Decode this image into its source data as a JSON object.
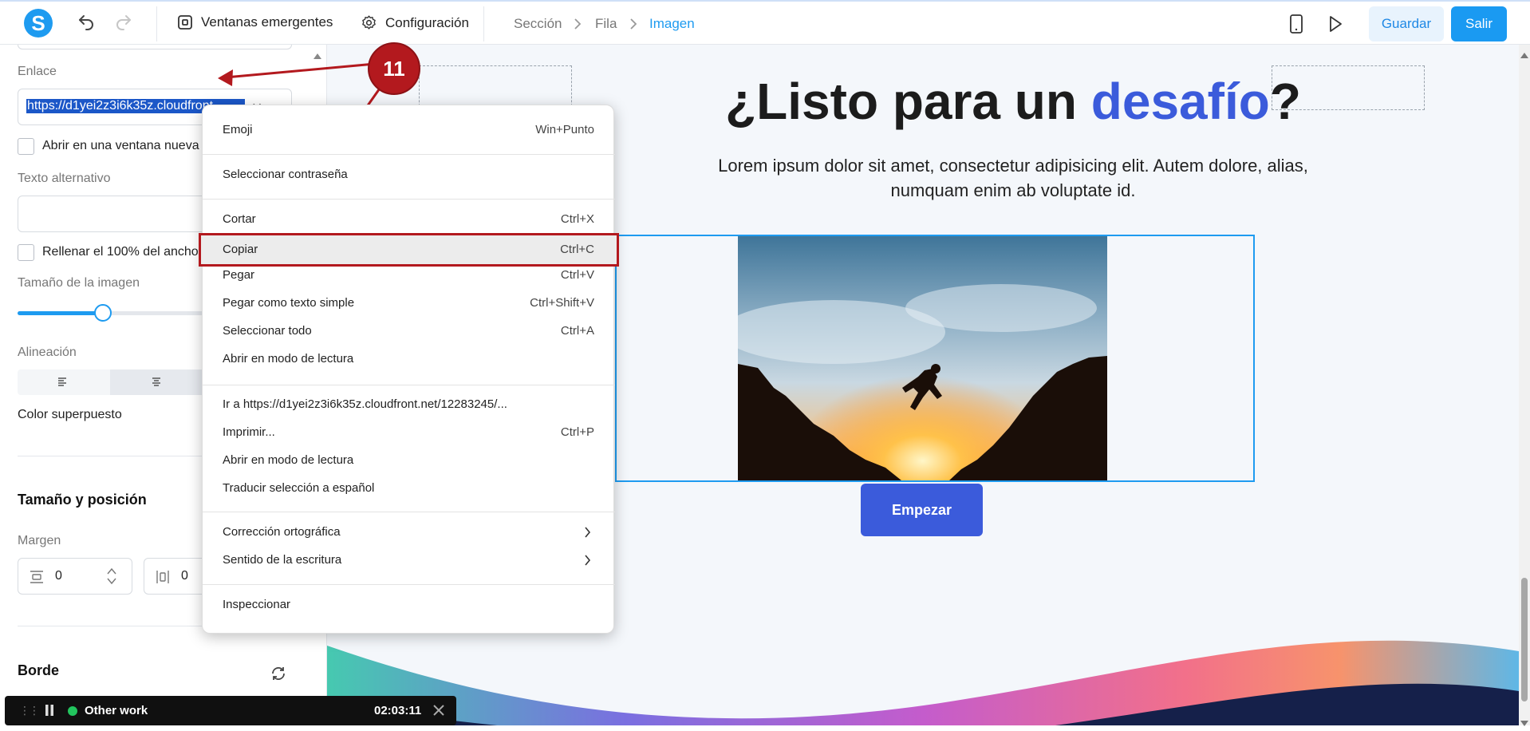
{
  "toolbar": {
    "logo": "S",
    "popups_label": "Ventanas emergentes",
    "settings_label": "Configuración",
    "breadcrumb": [
      "Sección",
      "Fila",
      "Imagen"
    ],
    "save_label": "Guardar",
    "exit_label": "Salir"
  },
  "left_panel": {
    "link_label": "Enlace",
    "link_value": "https://d1yei2z3i6k35z.cloudfront",
    "new_window_label": "Abrir en una ventana nueva",
    "alt_label": "Texto alternativo",
    "fill_width_label": "Rellenar el 100% del ancho",
    "image_size_label": "Tamaño de la imagen",
    "image_size_value": 0.5,
    "alignment_label": "Alineación",
    "overlay_label": "Color superpuesto",
    "size_position_title": "Tamaño y posición",
    "margin_label": "Margen",
    "margin_top": "0",
    "margin_side": "0",
    "border_title": "Borde"
  },
  "canvas": {
    "heading_part1": "¿Listo para un ",
    "heading_highlight": "desafío",
    "heading_part2": "?",
    "body_line1": "Lorem ipsum dolor sit amet, consectetur adipisicing elit. Autem dolore, alias,",
    "body_line2": "numquam enim ab voluptate id.",
    "cta_label": "Empezar",
    "accent_color": "#3b5bdb"
  },
  "annotation": {
    "step_number": "11",
    "color": "#b3191e"
  },
  "context_menu": {
    "items": [
      {
        "label": "Emoji",
        "shortcut": "Win+Punto"
      },
      {
        "label": "Seleccionar contraseña",
        "shortcut": ""
      },
      {
        "label": "Cortar",
        "shortcut": "Ctrl+X"
      },
      {
        "label": "Copiar",
        "shortcut": "Ctrl+C"
      },
      {
        "label": "Pegar",
        "shortcut": "Ctrl+V"
      },
      {
        "label": "Pegar como texto simple",
        "shortcut": "Ctrl+Shift+V"
      },
      {
        "label": "Seleccionar todo",
        "shortcut": "Ctrl+A"
      },
      {
        "label": "Abrir en modo de lectura",
        "shortcut": ""
      },
      {
        "label": "Ir a https://d1yei2z3i6k35z.cloudfront.net/12283245/...",
        "shortcut": ""
      },
      {
        "label": "Imprimir...",
        "shortcut": "Ctrl+P"
      },
      {
        "label": "Abrir en modo de lectura",
        "shortcut": ""
      },
      {
        "label": "Traducir selección a español",
        "shortcut": ""
      },
      {
        "label": "Corrección ortográfica",
        "shortcut": ""
      },
      {
        "label": "Sentido de la escritura",
        "shortcut": ""
      },
      {
        "label": "Inspeccionar",
        "shortcut": ""
      }
    ]
  },
  "timer_bar": {
    "label": "Other work",
    "time": "02:03:11"
  }
}
